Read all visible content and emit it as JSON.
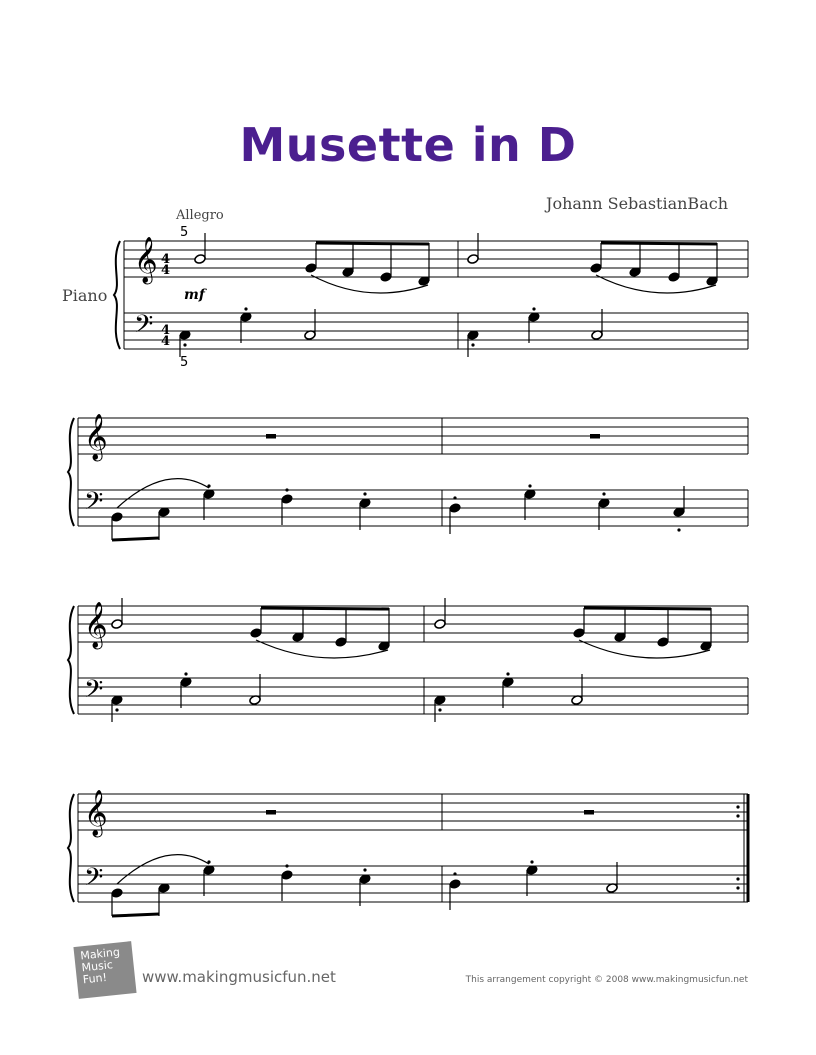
{
  "document": {
    "title": "Musette in D",
    "composer": "Johann SebastianBach",
    "tempo": "Allegro",
    "instrument": "Piano",
    "dynamic": "mf",
    "time_signature": [
      "4",
      "4"
    ],
    "fingering": [
      "5",
      "5"
    ]
  },
  "footer": {
    "logo_text": [
      "Making",
      "Music",
      "Fun!"
    ],
    "website": "www.makingmusicfun.net",
    "copyright": "This arrangement copyright © 2008 www.makingmusicfun.net"
  }
}
